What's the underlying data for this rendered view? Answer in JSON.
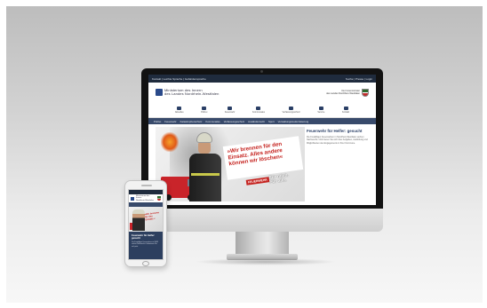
{
  "desktop": {
    "topbar": {
      "left": "Kontakt  |  Leichte Sprache  |  Gebärdensprache",
      "right": "Suche  |  Presse  |  Login"
    },
    "brand": {
      "line1": "Ministerium des Innern",
      "line2": "des Landes Nordrhein-Westfalen"
    },
    "state": {
      "line1": "Der Innenminister",
      "line2": "des Landes Nordrhein-Westfalen"
    },
    "icon_nav": [
      {
        "label": "Aktuelles"
      },
      {
        "label": "Polizei"
      },
      {
        "label": "Feuerwehr"
      },
      {
        "label": "Kommunales"
      },
      {
        "label": "Verfassungsschutz"
      },
      {
        "label": "Service"
      },
      {
        "label": "Kontakt"
      }
    ],
    "main_nav": [
      "Polizei",
      "Feuerwehr",
      "Katastrophenschutz",
      "Kommunales",
      "Verfassungsschutz",
      "Ausländerrecht",
      "Sport",
      "Verwaltungsmodernisierung"
    ],
    "hero": {
      "slogan": "»Wir brennen für den Einsatz. Alles andere können wir löschen«",
      "tag": "FEUERWEHR",
      "sub_line1": "Für mich.",
      "sub_line2": "Für alle."
    },
    "sidebar": {
      "title": "Feuerwehr für Helfer: gesucht",
      "body": "Die Freiwilligen Feuerwehren in Nordrhein-Westfalen suchen Nachwuchs. Informieren Sie sich über Aufgaben, Ausbildung und Möglichkeiten des Engagements in Ihrer Kommune."
    }
  },
  "phone": {
    "brand": {
      "line1": "Ministerium des Innern",
      "line2": "Nordrhein-Westfalen"
    },
    "slogan": "»Wir brennen für den Einsatz.«",
    "panel": {
      "title": "Feuerwehr für Helfer: gesucht",
      "body": "Die Freiwilligen Feuerwehren in NRW suchen Nachwuchs. Informieren Sie sich jetzt."
    }
  },
  "colors": {
    "header_dark": "#1f2b3d",
    "nav_blue": "#384a6b",
    "accent_red": "#c5231f",
    "background": "#d4d4d4"
  }
}
